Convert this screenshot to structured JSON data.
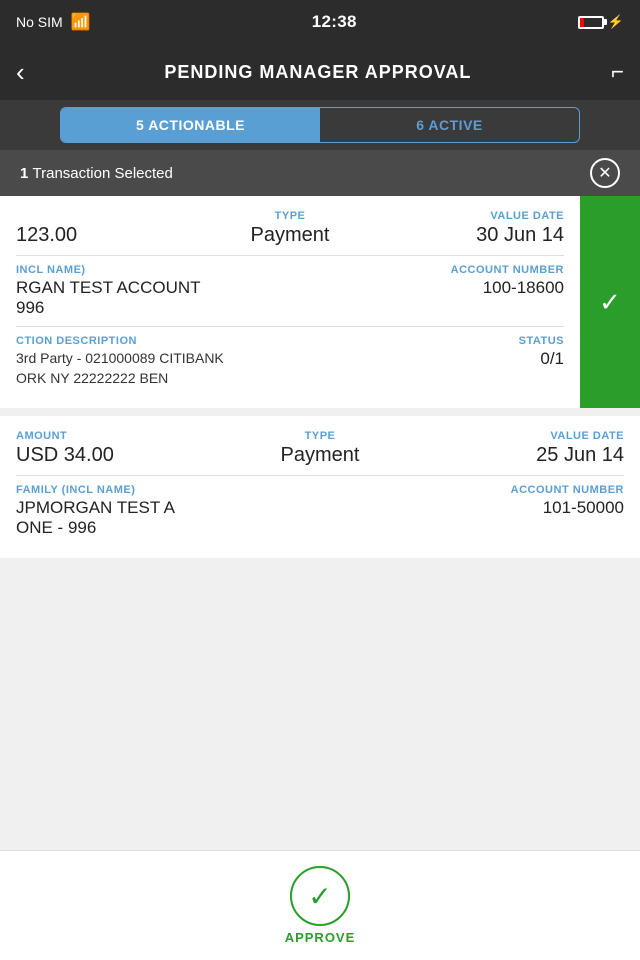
{
  "statusBar": {
    "carrier": "No SIM",
    "time": "12:38"
  },
  "navHeader": {
    "title": "PENDING MANAGER APPROVAL",
    "backLabel": "‹",
    "filterLabel": "⛉"
  },
  "tabs": [
    {
      "id": "actionable",
      "label": "5 ACTIONABLE",
      "active": true
    },
    {
      "id": "active",
      "label": "6 ACTIVE",
      "active": false
    }
  ],
  "selectionBar": {
    "count": "1",
    "text": "Transaction Selected"
  },
  "card1": {
    "amountLabel": "",
    "amount": "123.00",
    "typeLabel": "TYPE",
    "type": "Payment",
    "valueDateLabel": "VALUE DATE",
    "valueDate": "30 Jun 14",
    "familyLabel": "INCL NAME)",
    "familyValue": "RGAN TEST ACCOUNT\n996",
    "accountLabel": "ACCOUNT NUMBER",
    "accountValue": "100-18600",
    "descLabel": "CTION DESCRIPTION",
    "descValue": "3rd Party - 021000089 CITIBANK\nORK NY 22222222 BEN",
    "statusLabel": "STATUS",
    "statusValue": "0/1",
    "selected": true
  },
  "card2": {
    "amountLabel": "AMOUNT",
    "amount": "USD 34.00",
    "typeLabel": "TYPE",
    "type": "Payment",
    "valueDateLabel": "VALUE DATE",
    "valueDate": "25 Jun 14",
    "familyLabel": "FAMILY (INCL NAME)",
    "familyValue": "JPMORGAN TEST A",
    "familyValue2": "ONE - 996",
    "accountLabel": "ACCOUNT NUMBER",
    "accountValue": "101-50000",
    "selected": false
  },
  "approve": {
    "label": "APPROVE"
  }
}
